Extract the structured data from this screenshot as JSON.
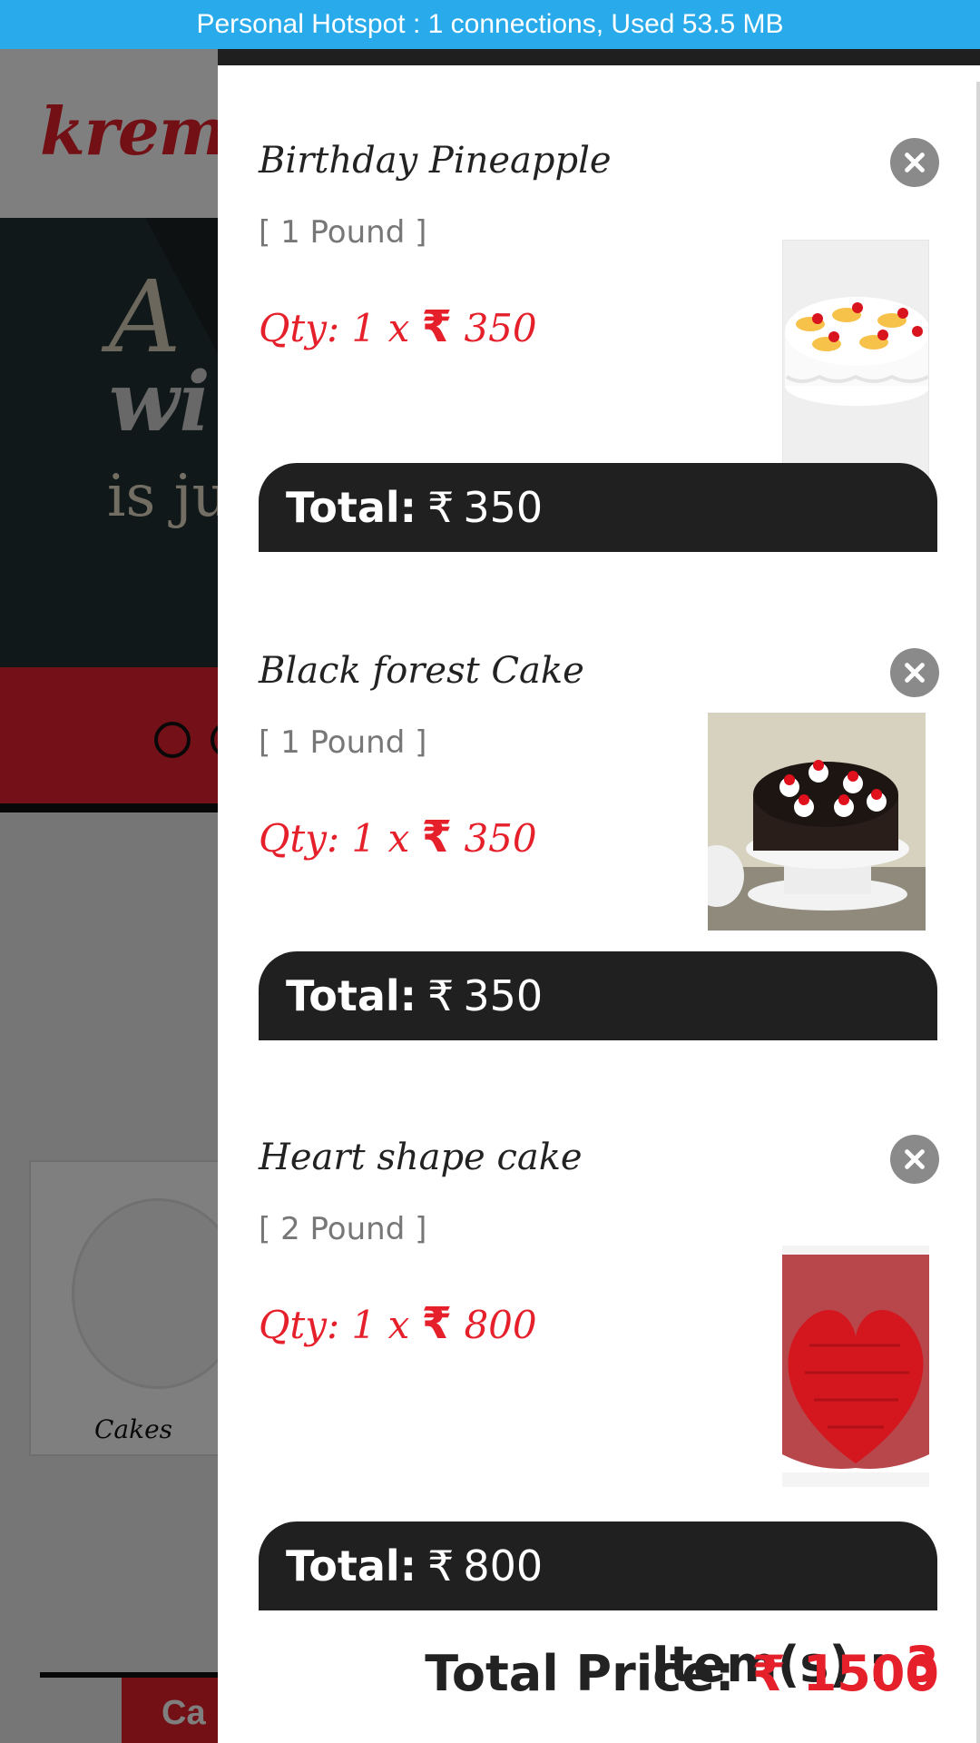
{
  "status_bar": {
    "text": "Personal Hotspot : 1 connections, Used 53.5 MB"
  },
  "background": {
    "logo": "kremyk",
    "hero_line1": "A",
    "hero_line2": "wi",
    "hero_line3": "is jus",
    "category_label": "Cakes",
    "bottom_button": "Ca"
  },
  "cart": {
    "currency_symbol": "₹",
    "items": [
      {
        "name": "Birthday Pineapple",
        "weight": "[ 1 Pound ]",
        "qty_label": "Qty: 1 x",
        "price": "350",
        "total_label": "Total:",
        "total": "350",
        "image": "pineapple-cake"
      },
      {
        "name": "Black forest Cake",
        "weight": "[ 1 Pound ]",
        "qty_label": "Qty: 1 x",
        "price": "350",
        "total_label": "Total:",
        "total": "350",
        "image": "black-forest-cake"
      },
      {
        "name": "Heart shape cake",
        "weight": "[ 2 Pound ]",
        "qty_label": "Qty: 1 x",
        "price": "800",
        "total_label": "Total:",
        "total": "800",
        "image": "heart-red-velvet-cake"
      }
    ],
    "summary": {
      "items_label": "Item(s) :",
      "items_count": "3",
      "price_label": "Total Price:",
      "total_price": "1500"
    }
  },
  "colors": {
    "accent": "#e5202b",
    "status_bar": "#29aaeb",
    "dark_bar": "#202020",
    "remove_button": "#8a8a8a"
  }
}
